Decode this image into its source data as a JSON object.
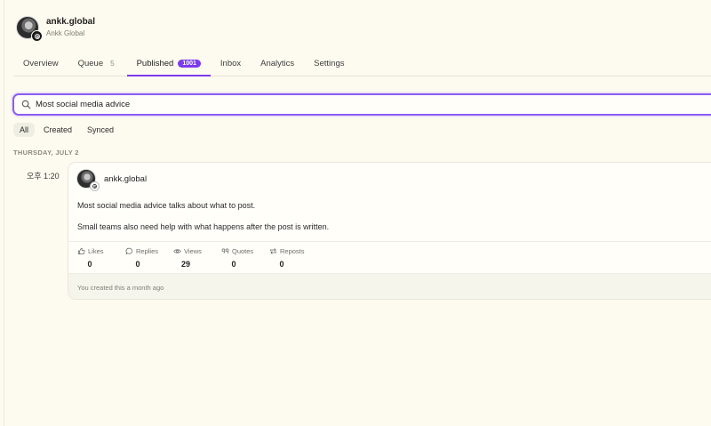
{
  "account": {
    "handle": "ankk.global",
    "display_name": "Ankk Global"
  },
  "tabs": [
    {
      "label": "Overview"
    },
    {
      "label": "Queue",
      "count": "5"
    },
    {
      "label": "Published",
      "count": "1001",
      "active": true
    },
    {
      "label": "Inbox"
    },
    {
      "label": "Analytics"
    },
    {
      "label": "Settings"
    }
  ],
  "search": {
    "value": "Most social media advice",
    "placeholder": "Search"
  },
  "filters": [
    {
      "label": "All",
      "active": true
    },
    {
      "label": "Created"
    },
    {
      "label": "Synced"
    }
  ],
  "feed": {
    "date_header": "THURSDAY, JULY 2",
    "post": {
      "time": "오후 1:20",
      "author": "ankk.global",
      "paragraphs": [
        "Most social media advice talks about what to post.",
        "Small teams also need help with what happens after the post is written."
      ],
      "metrics": [
        {
          "label": "Likes",
          "value": "0",
          "icon": "heart-icon"
        },
        {
          "label": "Replies",
          "value": "0",
          "icon": "reply-icon"
        },
        {
          "label": "Views",
          "value": "29",
          "icon": "eye-icon"
        },
        {
          "label": "Quotes",
          "value": "0",
          "icon": "quote-icon"
        },
        {
          "label": "Reposts",
          "value": "0",
          "icon": "repost-icon"
        }
      ],
      "footer": "You created this a month ago"
    }
  },
  "colors": {
    "accent": "#7c3aed",
    "background": "#fdfbef"
  }
}
